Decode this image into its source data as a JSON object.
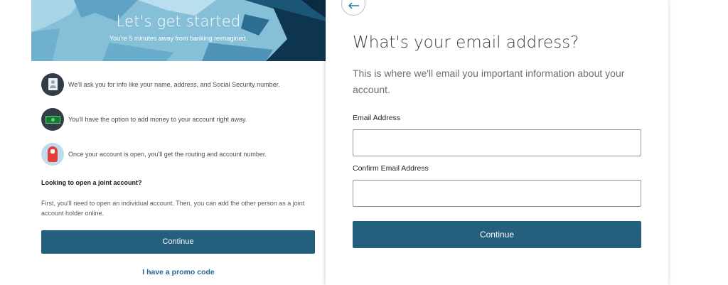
{
  "left": {
    "hero": {
      "title": "Let's get started",
      "subtitle": "You're 5 minutes away from banking reimagined."
    },
    "info_items": [
      {
        "icon": "id-card-icon",
        "text": "We'll ask you for info like your name, address, and Social Security number."
      },
      {
        "icon": "money-icon",
        "text": "You'll have the option to add money to your account right away."
      },
      {
        "icon": "foam-finger-icon",
        "text": "Once your account is open, you'll get the routing and account number."
      }
    ],
    "joint": {
      "title": "Looking to open a joint account?",
      "body": "First, you'll need to open an individual account. Then, you can add the other person as a joint account holder online."
    },
    "continue_label": "Continue",
    "promo_label": "I have a promo code"
  },
  "right": {
    "back_icon": "arrow-left-icon",
    "title": "What's your email address?",
    "subtitle": "This is where we'll email you important information about your account.",
    "email": {
      "label": "Email Address",
      "value": "",
      "placeholder": ""
    },
    "confirm_email": {
      "label": "Confirm Email Address",
      "value": "",
      "placeholder": ""
    },
    "continue_label": "Continue"
  },
  "colors": {
    "primary_button": "#255f7e",
    "link": "#1d6b96",
    "hero_sky": "#86bfd8",
    "hero_dark": "#0e3550",
    "badge_dark": "#313c49"
  }
}
